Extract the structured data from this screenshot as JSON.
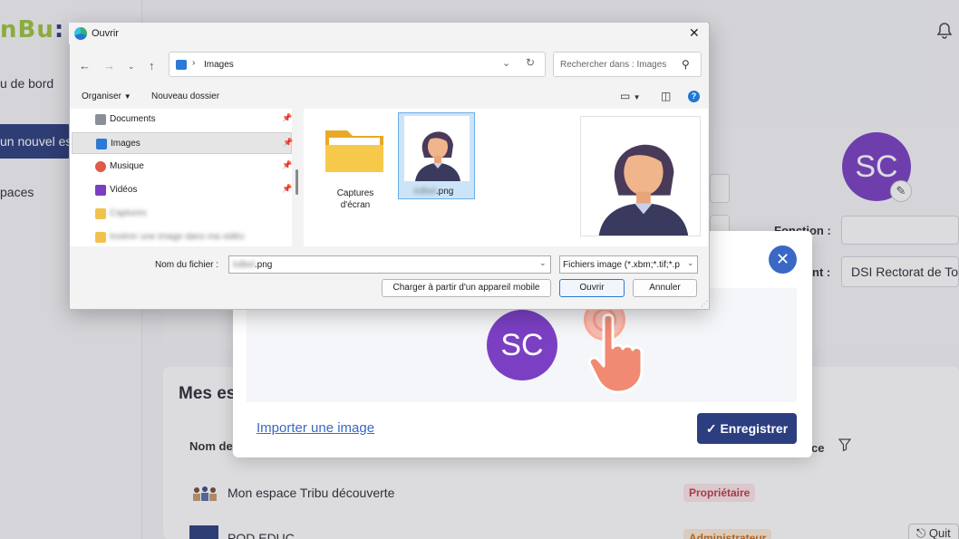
{
  "app": {
    "logo_text": "nBu",
    "logo_colon": ":",
    "sidebar": {
      "dashboard": "u de bord",
      "new_space": "un nouvel es",
      "spaces": "paces"
    },
    "profile": {
      "avatar_initials": "SC",
      "function_label": "Fonction :",
      "establishment_label_partial": "nt :",
      "establishment_value": "DSI Rectorat de Toulouse"
    },
    "spaces": {
      "title": "Mes es",
      "col_name": "Nom de",
      "col_role": "ce",
      "rows": [
        {
          "name": "Mon espace Tribu découverte",
          "role": "Propriétaire"
        },
        {
          "name": "POD EDUC",
          "role": "Administrateur",
          "action": "Quit"
        }
      ]
    }
  },
  "modal": {
    "avatar_initials": "SC",
    "import_link": "Importer une image",
    "save_button": "Enregistrer",
    "close_symbol": "✕"
  },
  "dialog": {
    "title": "Ouvrir",
    "close_symbol": "✕",
    "address_path": "Images",
    "search_placeholder": "Rechercher dans : Images",
    "organize": "Organiser",
    "new_folder": "Nouveau dossier",
    "nav_items": [
      {
        "label": "Documents"
      },
      {
        "label": "Images"
      },
      {
        "label": "Musique"
      },
      {
        "label": "Vidéos"
      },
      {
        "label": "Captures"
      },
      {
        "label": "Insérer une image dans ma vidéo"
      }
    ],
    "files": [
      {
        "label": "Captures d'écran"
      },
      {
        "label": ".png",
        "blurred_prefix": "tolbel"
      }
    ],
    "filename_label": "Nom du fichier :",
    "filename_value": ".png",
    "filename_blurred": "tolbel",
    "filter_value": "Fichiers image (*.xbm;*.tif;*.p",
    "mobile_button": "Charger à partir d'un appareil mobile",
    "open_button": "Ouvrir",
    "cancel_button": "Annuler"
  }
}
